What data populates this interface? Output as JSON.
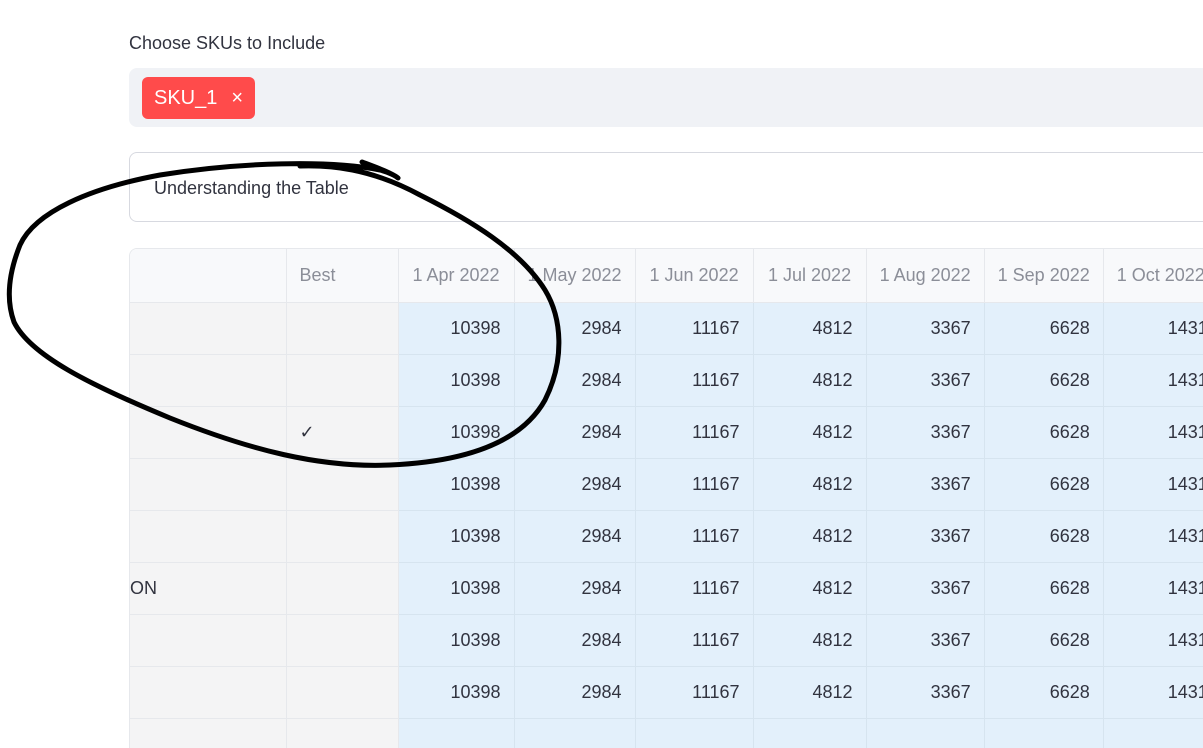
{
  "sku_select": {
    "label": "Choose SKUs to Include",
    "selected": [
      {
        "text": "SKU_1",
        "remove_glyph": "×"
      }
    ]
  },
  "expander": {
    "title": "Understanding the Table"
  },
  "table": {
    "headers": {
      "index": "",
      "best": "Best",
      "months": [
        "1 Apr 2022",
        "1 May 2022",
        "1 Jun 2022",
        "1 Jul 2022",
        "1 Aug 2022",
        "1 Sep 2022",
        "1 Oct 2022"
      ]
    },
    "rows": [
      {
        "index": "",
        "best": "",
        "values": [
          "10398",
          "2984",
          "11167",
          "4812",
          "3367",
          "6628",
          "1431"
        ]
      },
      {
        "index": "",
        "best": "",
        "values": [
          "10398",
          "2984",
          "11167",
          "4812",
          "3367",
          "6628",
          "1431"
        ]
      },
      {
        "index": "",
        "best": "✓",
        "values": [
          "10398",
          "2984",
          "11167",
          "4812",
          "3367",
          "6628",
          "1431"
        ]
      },
      {
        "index": "",
        "best": "",
        "values": [
          "10398",
          "2984",
          "11167",
          "4812",
          "3367",
          "6628",
          "1431"
        ]
      },
      {
        "index": "",
        "best": "",
        "values": [
          "10398",
          "2984",
          "11167",
          "4812",
          "3367",
          "6628",
          "1431"
        ]
      },
      {
        "index": "ON",
        "best": "",
        "values": [
          "10398",
          "2984",
          "11167",
          "4812",
          "3367",
          "6628",
          "1431"
        ]
      },
      {
        "index": "",
        "best": "",
        "values": [
          "10398",
          "2984",
          "11167",
          "4812",
          "3367",
          "6628",
          "1431"
        ]
      },
      {
        "index": "",
        "best": "",
        "values": [
          "10398",
          "2984",
          "11167",
          "4812",
          "3367",
          "6628",
          "1431"
        ]
      },
      {
        "index": "",
        "best": "",
        "values": [
          "",
          "",
          "",
          "",
          "",
          "",
          ""
        ]
      }
    ]
  },
  "colors": {
    "chip": "#ff4b4b",
    "value_cells": "#e3f0fb",
    "index_cells": "#f4f4f5",
    "annotation_stroke": "#000000"
  }
}
